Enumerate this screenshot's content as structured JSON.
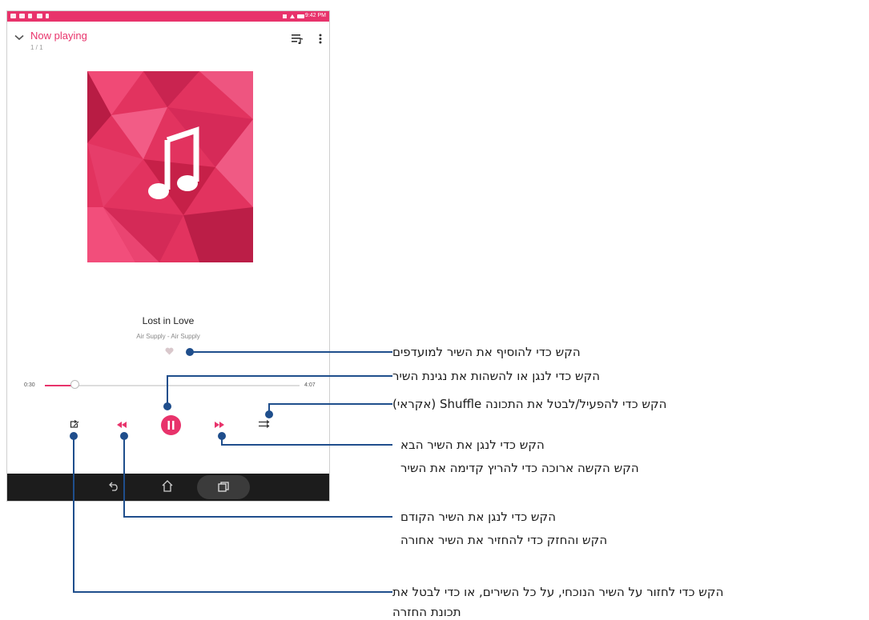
{
  "status_bar": {
    "time": "9:42 PM"
  },
  "header": {
    "title": "Now playing",
    "position": "1 / 1"
  },
  "track": {
    "title": "Lost in Love",
    "artist": "Air Supply - Air Supply"
  },
  "playback": {
    "elapsed": "0:30",
    "total": "4:07",
    "progress": 0.121
  },
  "colors": {
    "accent": "#e8336b",
    "callout_line": "#1f4e8c",
    "navbar": "#1c1c1c"
  },
  "icons": {
    "back": "chevron-down-icon",
    "queue": "queue-list-icon",
    "more": "more-vert-icon",
    "favorite": "heart-icon",
    "repeat": "repeat-icon",
    "previous": "skip-previous-icon",
    "play_pause": "pause-icon",
    "next": "skip-next-icon",
    "shuffle": "shuffle-icon",
    "album_art": "music-note-icon"
  },
  "callouts": {
    "favorite": [
      "הקש כדי להוסיף את השיר למועדפים"
    ],
    "play_pause": [
      "הקש כדי לנגן או להשהות את נגינת השיר"
    ],
    "shuffle": [
      "הקש כדי להפעיל/לבטל את התכונה Shuffle (אקראי)"
    ],
    "next": [
      "הקש כדי לנגן את השיר הבא",
      "הקש הקשה ארוכה כדי להריץ קדימה את השיר"
    ],
    "previous": [
      "הקש כדי לנגן את השיר הקודם",
      "הקש והחזק כדי להחזיר את השיר אחורה"
    ],
    "repeat": [
      "הקש כדי לחזור על השיר הנוכחי, על כל השירים, או כדי לבטל את",
      "תכונת החזרה"
    ]
  }
}
